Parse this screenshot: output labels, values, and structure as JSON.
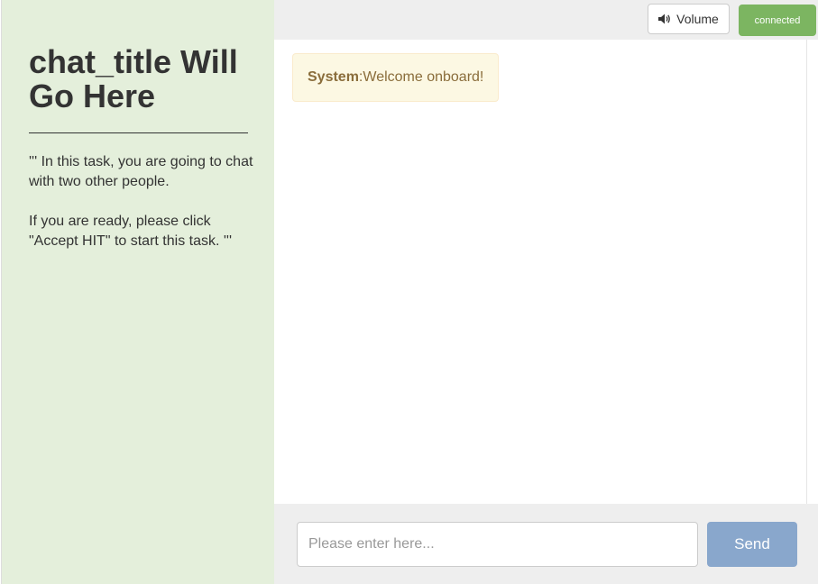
{
  "sidebar": {
    "title": "chat_title Will Go Here",
    "paragraphs": [
      "''' In this task, you are going to chat with two other people.",
      "If you are ready, please click \"Accept HIT\" to start this task. '''"
    ]
  },
  "toolbar": {
    "volume_label": "Volume",
    "volume_icon": "speaker-icon",
    "status_label": "connected"
  },
  "chat": {
    "messages": [
      {
        "sender": "System",
        "separator": ": ",
        "text": "Welcome onboard!"
      }
    ]
  },
  "composer": {
    "placeholder": "Please enter here...",
    "value": "",
    "send_label": "Send"
  },
  "colors": {
    "sidebar_bg": "#e4efdb",
    "status_connected": "#7cb561",
    "send_button": "#89a7cc",
    "system_message_bg": "#fcf8e3",
    "system_message_text": "#8a6d3b"
  }
}
